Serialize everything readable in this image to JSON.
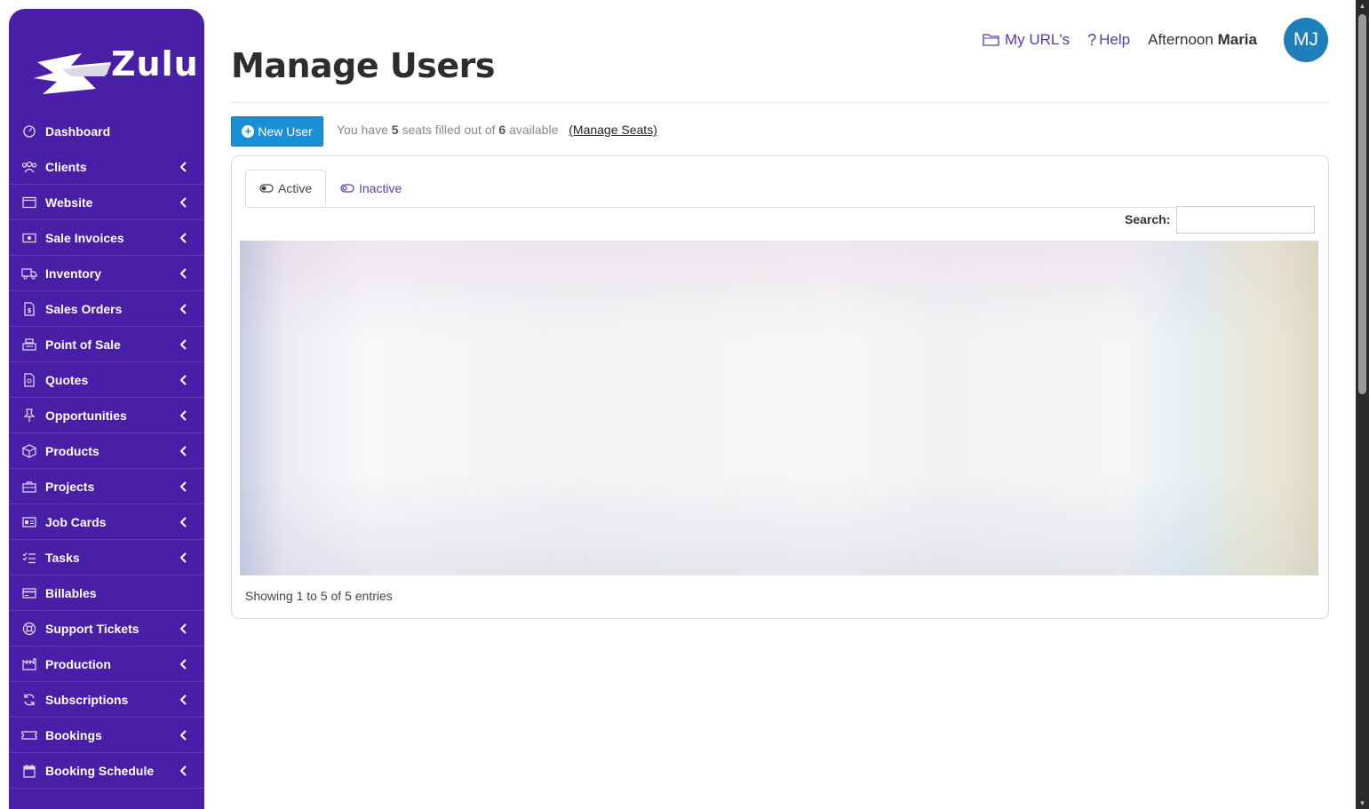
{
  "brand": {
    "name": "Zulu"
  },
  "sidebar": {
    "items": [
      {
        "label": "Dashboard",
        "icon": "dashboard-icon",
        "chevron": false
      },
      {
        "label": "Clients",
        "icon": "users-icon",
        "chevron": true
      },
      {
        "label": "Website",
        "icon": "window-icon",
        "chevron": true
      },
      {
        "label": "Sale Invoices",
        "icon": "money-icon",
        "chevron": true
      },
      {
        "label": "Inventory",
        "icon": "truck-icon",
        "chevron": true
      },
      {
        "label": "Sales Orders",
        "icon": "invoice-icon",
        "chevron": true
      },
      {
        "label": "Point of Sale",
        "icon": "register-icon",
        "chevron": true
      },
      {
        "label": "Quotes",
        "icon": "quote-doc-icon",
        "chevron": true
      },
      {
        "label": "Opportunities",
        "icon": "pin-icon",
        "chevron": true
      },
      {
        "label": "Products",
        "icon": "box-icon",
        "chevron": true
      },
      {
        "label": "Projects",
        "icon": "briefcase-icon",
        "chevron": true
      },
      {
        "label": "Job Cards",
        "icon": "id-card-icon",
        "chevron": true
      },
      {
        "label": "Tasks",
        "icon": "checklist-icon",
        "chevron": true
      },
      {
        "label": "Billables",
        "icon": "credit-card-icon",
        "chevron": false
      },
      {
        "label": "Support Tickets",
        "icon": "lifebuoy-icon",
        "chevron": true
      },
      {
        "label": "Production",
        "icon": "factory-icon",
        "chevron": true
      },
      {
        "label": "Subscriptions",
        "icon": "refresh-icon",
        "chevron": true
      },
      {
        "label": "Bookings",
        "icon": "ticket-icon",
        "chevron": true
      },
      {
        "label": "Booking Schedule",
        "icon": "calendar-icon",
        "chevron": true
      }
    ]
  },
  "header": {
    "title": "Manage Users",
    "links": {
      "my_urls": "My URL's",
      "help": "Help"
    },
    "greeting_prefix": "Afternoon",
    "user_name": "Maria",
    "avatar_initials": "MJ"
  },
  "toolbar": {
    "new_user_label": "New User",
    "seats_prefix": "You have",
    "seats_filled": "5",
    "seats_middle": "seats filled out of",
    "seats_total": "6",
    "seats_suffix": "available",
    "manage_seats_label": "(Manage Seats)"
  },
  "tabs": {
    "active": "Active",
    "inactive": "Inactive"
  },
  "search": {
    "label": "Search:",
    "value": ""
  },
  "table": {
    "footer": "Showing 1 to 5 of 5 entries"
  },
  "colors": {
    "sidebar": "#4a1fa8",
    "primary_button": "#1a8fd6",
    "link": "#5b3aa8",
    "avatar": "#1f7fba"
  }
}
